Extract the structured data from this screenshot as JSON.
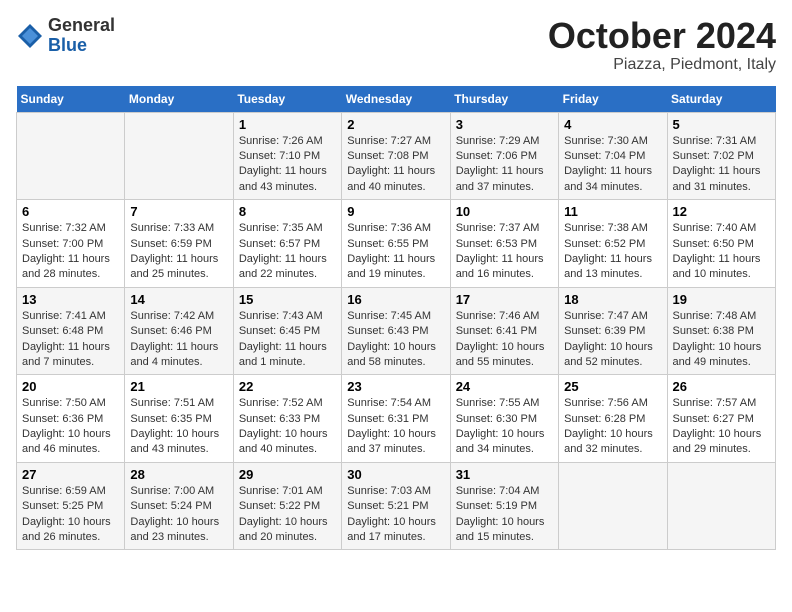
{
  "header": {
    "logo_general": "General",
    "logo_blue": "Blue",
    "title": "October 2024",
    "location": "Piazza, Piedmont, Italy"
  },
  "calendar": {
    "days_of_week": [
      "Sunday",
      "Monday",
      "Tuesday",
      "Wednesday",
      "Thursday",
      "Friday",
      "Saturday"
    ],
    "weeks": [
      [
        {
          "day": "",
          "info": ""
        },
        {
          "day": "",
          "info": ""
        },
        {
          "day": "1",
          "info": "Sunrise: 7:26 AM\nSunset: 7:10 PM\nDaylight: 11 hours and 43 minutes."
        },
        {
          "day": "2",
          "info": "Sunrise: 7:27 AM\nSunset: 7:08 PM\nDaylight: 11 hours and 40 minutes."
        },
        {
          "day": "3",
          "info": "Sunrise: 7:29 AM\nSunset: 7:06 PM\nDaylight: 11 hours and 37 minutes."
        },
        {
          "day": "4",
          "info": "Sunrise: 7:30 AM\nSunset: 7:04 PM\nDaylight: 11 hours and 34 minutes."
        },
        {
          "day": "5",
          "info": "Sunrise: 7:31 AM\nSunset: 7:02 PM\nDaylight: 11 hours and 31 minutes."
        }
      ],
      [
        {
          "day": "6",
          "info": "Sunrise: 7:32 AM\nSunset: 7:00 PM\nDaylight: 11 hours and 28 minutes."
        },
        {
          "day": "7",
          "info": "Sunrise: 7:33 AM\nSunset: 6:59 PM\nDaylight: 11 hours and 25 minutes."
        },
        {
          "day": "8",
          "info": "Sunrise: 7:35 AM\nSunset: 6:57 PM\nDaylight: 11 hours and 22 minutes."
        },
        {
          "day": "9",
          "info": "Sunrise: 7:36 AM\nSunset: 6:55 PM\nDaylight: 11 hours and 19 minutes."
        },
        {
          "day": "10",
          "info": "Sunrise: 7:37 AM\nSunset: 6:53 PM\nDaylight: 11 hours and 16 minutes."
        },
        {
          "day": "11",
          "info": "Sunrise: 7:38 AM\nSunset: 6:52 PM\nDaylight: 11 hours and 13 minutes."
        },
        {
          "day": "12",
          "info": "Sunrise: 7:40 AM\nSunset: 6:50 PM\nDaylight: 11 hours and 10 minutes."
        }
      ],
      [
        {
          "day": "13",
          "info": "Sunrise: 7:41 AM\nSunset: 6:48 PM\nDaylight: 11 hours and 7 minutes."
        },
        {
          "day": "14",
          "info": "Sunrise: 7:42 AM\nSunset: 6:46 PM\nDaylight: 11 hours and 4 minutes."
        },
        {
          "day": "15",
          "info": "Sunrise: 7:43 AM\nSunset: 6:45 PM\nDaylight: 11 hours and 1 minute."
        },
        {
          "day": "16",
          "info": "Sunrise: 7:45 AM\nSunset: 6:43 PM\nDaylight: 10 hours and 58 minutes."
        },
        {
          "day": "17",
          "info": "Sunrise: 7:46 AM\nSunset: 6:41 PM\nDaylight: 10 hours and 55 minutes."
        },
        {
          "day": "18",
          "info": "Sunrise: 7:47 AM\nSunset: 6:39 PM\nDaylight: 10 hours and 52 minutes."
        },
        {
          "day": "19",
          "info": "Sunrise: 7:48 AM\nSunset: 6:38 PM\nDaylight: 10 hours and 49 minutes."
        }
      ],
      [
        {
          "day": "20",
          "info": "Sunrise: 7:50 AM\nSunset: 6:36 PM\nDaylight: 10 hours and 46 minutes."
        },
        {
          "day": "21",
          "info": "Sunrise: 7:51 AM\nSunset: 6:35 PM\nDaylight: 10 hours and 43 minutes."
        },
        {
          "day": "22",
          "info": "Sunrise: 7:52 AM\nSunset: 6:33 PM\nDaylight: 10 hours and 40 minutes."
        },
        {
          "day": "23",
          "info": "Sunrise: 7:54 AM\nSunset: 6:31 PM\nDaylight: 10 hours and 37 minutes."
        },
        {
          "day": "24",
          "info": "Sunrise: 7:55 AM\nSunset: 6:30 PM\nDaylight: 10 hours and 34 minutes."
        },
        {
          "day": "25",
          "info": "Sunrise: 7:56 AM\nSunset: 6:28 PM\nDaylight: 10 hours and 32 minutes."
        },
        {
          "day": "26",
          "info": "Sunrise: 7:57 AM\nSunset: 6:27 PM\nDaylight: 10 hours and 29 minutes."
        }
      ],
      [
        {
          "day": "27",
          "info": "Sunrise: 6:59 AM\nSunset: 5:25 PM\nDaylight: 10 hours and 26 minutes."
        },
        {
          "day": "28",
          "info": "Sunrise: 7:00 AM\nSunset: 5:24 PM\nDaylight: 10 hours and 23 minutes."
        },
        {
          "day": "29",
          "info": "Sunrise: 7:01 AM\nSunset: 5:22 PM\nDaylight: 10 hours and 20 minutes."
        },
        {
          "day": "30",
          "info": "Sunrise: 7:03 AM\nSunset: 5:21 PM\nDaylight: 10 hours and 17 minutes."
        },
        {
          "day": "31",
          "info": "Sunrise: 7:04 AM\nSunset: 5:19 PM\nDaylight: 10 hours and 15 minutes."
        },
        {
          "day": "",
          "info": ""
        },
        {
          "day": "",
          "info": ""
        }
      ]
    ]
  }
}
